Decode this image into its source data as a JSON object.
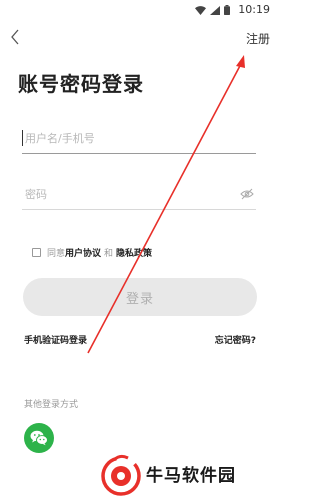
{
  "status_bar": {
    "time": "10:19"
  },
  "nav": {
    "register_label": "注册"
  },
  "page": {
    "title": "账号密码登录"
  },
  "form": {
    "username_placeholder": "用户名/手机号",
    "password_placeholder": "密码"
  },
  "agreement": {
    "prefix": "同意",
    "user_agreement": "用户协议",
    "and": "和",
    "privacy_policy": "隐私政策"
  },
  "actions": {
    "login_label": "登录",
    "sms_login_label": "手机验证码登录",
    "forgot_password_label": "忘记密码?"
  },
  "other_login": {
    "label": "其他登录方式"
  },
  "watermark": {
    "text": "牛马软件园"
  },
  "colors": {
    "login_button_bg": "#e8e8e8",
    "wechat_green": "#2db34a",
    "annotation_red": "#e8302a"
  },
  "icons": [
    "wifi-icon",
    "signal-icon",
    "battery-icon",
    "back-arrow-icon",
    "eye-off-icon",
    "wechat-icon"
  ]
}
